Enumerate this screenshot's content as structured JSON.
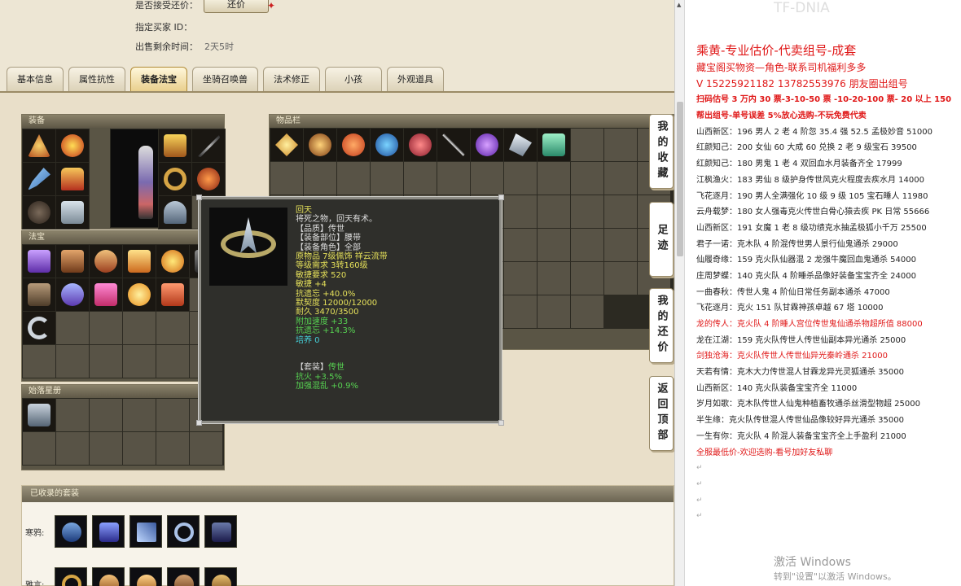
{
  "trade_info": {
    "accept_counter_label": "是否接受还价：",
    "counter_button": "还价",
    "buyer_label": "指定买家 ID：",
    "time_label": "出售剩余时间：",
    "time_value": "2天5时"
  },
  "tabs": [
    {
      "label": "基本信息"
    },
    {
      "label": "属性抗性"
    },
    {
      "label": "装备法宝",
      "active": true
    },
    {
      "label": "坐骑召唤兽"
    },
    {
      "label": "法术修正"
    },
    {
      "label": "小孩"
    },
    {
      "label": "外观道具"
    }
  ],
  "panels": {
    "equip": "装备",
    "fabao": "法宝",
    "inventory": "物品栏",
    "star_map": "始落星册"
  },
  "tooltip": {
    "name": "回天",
    "desc": "将死之物，回天有术。",
    "quality": "【品质】传世",
    "slot": "【装备部位】腰带",
    "role": "【装备角色】全部",
    "origin": "原物品 7级佩饰 祥云流带",
    "level_req": "等级需求 3转160级",
    "agility_req": "敏捷要求 520",
    "agility": "敏捷 +4",
    "forget_res": "抗遗忘 +40.0%",
    "tacit": "默契度 12000/12000",
    "durability": "耐久 3470/3500",
    "speed_add": "附加速度 +33",
    "forget_res2": "抗遗忘 +14.3%",
    "culture": "培养 0",
    "set_label": "【套装】",
    "set_value": "传世",
    "chaos_res": "抗火 +3.5%",
    "confuse_boost": "加强混乱 +0.9%"
  },
  "side_buttons": [
    {
      "label": "我的收藏"
    },
    {
      "label": "足迹"
    },
    {
      "label": "我的还价"
    },
    {
      "label": "返回顶部"
    }
  ],
  "suits": {
    "header": "已收录的套装",
    "row1_label": "寒鸦:",
    "row2_label": "雅言:"
  },
  "note": {
    "title": "乘黄-专业估价-代卖组号-成套",
    "line2": "藏宝阁买物资—角色-联系司机福利多多",
    "line3": "V 15225921182   13782553976 朋友圈出组号",
    "line4": "扫码估号 3 万内 30 票-3-10-50 票  -10-20-100 票- 20 以上 150",
    "line5": "帮出组号-单号误差 5%放心选购-不玩免费代卖",
    "entries": [
      "山西新区：196 男人 2 老 4 阶忽 35.4 强 52.5 孟极妙音 51000",
      "红颜知己：200 女仙 60 大成 60 兑换 2 老 9 级宝石 39500",
      "红颜知己：180 男鬼 1 老 4 双回血水月装备齐全 17999",
      "江枫渔火：183 男仙 8 级护身传世风克火程度去疾水月 14000",
      "飞花逐月：190 男人全满强化 10 级 9 级 105 宝石睡人 11980",
      "云舟载梦：180 女人强毒克火传世白骨心猿去疾 PK 日常 55666",
      "山西新区：191 女魔 1 老 8 级功绩克水抽孟极狐小千万 25500",
      "君子一诺：克木队 4 阶混传世男人景行仙鬼通杀 29000",
      "仙履奇缘：159 克火队仙器混 2 龙强牛魔回血鬼通杀 54000",
      "庄周梦蝶：140 克火队 4 阶睡杀品像好装备宝宝齐全 24000",
      "一曲春秋：传世人鬼 4 阶仙日常任务副本通杀 47000",
      "飞花逐月：克火 151 队甘霖神孩卓越 67 塔 10000",
      "龙的传人：克火队 4 阶睡人宫位传世鬼仙通杀物超所值 88000",
      "龙在江湖：159 克火队传世人传世仙副本异光通杀 25000",
      "剑独沧海：克火队传世人传世仙异光秦岭通杀 21000",
      "天若有情：克木大力传世混人甘霖龙异光灵狐通杀 35000",
      "山西新区：140 克火队装备宝宝齐全 11000",
      "岁月如歌：克木队传世人仙鬼种植畜牧通杀丝滑型物超 25000",
      "半生缘：克火队传世混人传世仙品像较好异光通杀 35000",
      "一生有你：克火队 4 阶混人装备宝宝齐全上手盈利 21000"
    ],
    "footer": "全服最低价-欢迎选购-看号加好友私聊"
  },
  "watermark": "TF-DNIA",
  "activate": {
    "line1": "激活 Windows",
    "line2": "转到\"设置\"以激活 Windows。"
  },
  "colors": {
    "red": "#e01818",
    "gold_tab": "#e9cf8d",
    "tooltip_yellow": "#e5e05a",
    "tooltip_green": "#57d352",
    "tooltip_cyan": "#45d0d8"
  }
}
